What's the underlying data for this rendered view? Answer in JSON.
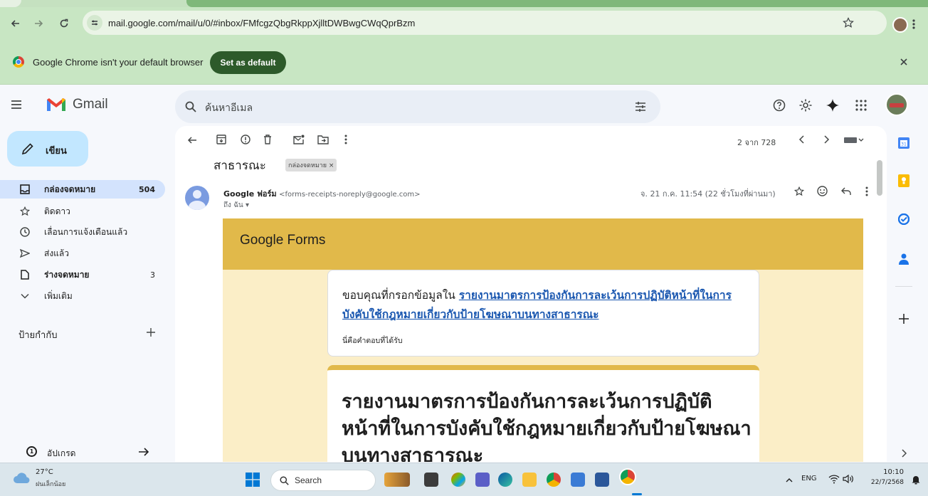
{
  "browser": {
    "url": "mail.google.com/mail/u/0/#inbox/FMfcgzQbgRkppXjlltDWBwgCWqQprBzm",
    "infobar_message": "Google Chrome isn't your default browser",
    "set_default_label": "Set as default"
  },
  "gmail": {
    "logo_text": "Gmail",
    "search_placeholder": "ค้นหาอีเมล",
    "compose_label": "เขียน",
    "nav": [
      {
        "label": "กล่องจดหมาย",
        "count": "504"
      },
      {
        "label": "ติดดาว",
        "count": ""
      },
      {
        "label": "เลื่อนการแจ้งเตือนแล้ว",
        "count": ""
      },
      {
        "label": "ส่งแล้ว",
        "count": ""
      },
      {
        "label": "ร่างจดหมาย",
        "count": "3"
      },
      {
        "label": "เพิ่มเติม",
        "count": ""
      }
    ],
    "labels_heading": "ป้ายกำกับ",
    "upgrade_label": "อัปเกรด",
    "pagination": "2 จาก 728"
  },
  "email": {
    "subject_fragment": "สาธารณะ",
    "label_chip": "กล่องจดหมาย ×",
    "sender_name": "Google ฟอร์ม",
    "sender_email": "<forms-receipts-noreply@google.com>",
    "to_line": "ถึง ฉัน ▾",
    "date": "จ. 21 ก.ค. 11:54 (22 ชั่วโมงที่ผ่านมา)",
    "forms_logo": "Google Forms",
    "thanks_prefix": "ขอบคุณที่กรอกข้อมูลใน ",
    "form_link": "รายงานมาตรการป้องกันการละเว้นการปฏิบัติหน้าที่ในการบังคับใช้กฎหมายเกี่ยวกับป้ายโฆษณาบนทางสาธารณะ",
    "received_note": "นี่คือคำตอบที่ได้รับ",
    "form_title": "รายงานมาตรการป้องกันการละเว้นการปฏิบัติหน้าที่ในการบังคับใช้กฎหมายเกี่ยวกับป้ายโฆษณาบนทางสาธารณะ"
  },
  "taskbar": {
    "weather_temp": "27°C",
    "weather_desc": "ฝนเล็กน้อย",
    "search_label": "Search",
    "lang": "ENG",
    "time": "10:10",
    "date": "22/7/2568"
  },
  "colors": {
    "chrome_green": "#c8e6c3",
    "compose_blue": "#c2e7ff",
    "inbox_selected": "#d3e3fd",
    "forms_gold": "#e1b94a"
  }
}
